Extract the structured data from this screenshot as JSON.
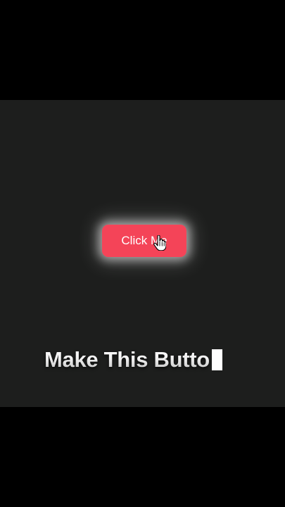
{
  "demo": {
    "button_label": "Click Me",
    "button_color": "#f44458",
    "button_glow": "#ffffff",
    "cursor_icon": "hand-pointer-icon"
  },
  "caption": {
    "text": "Make This Butto"
  },
  "colors": {
    "letterbox": "#000000",
    "stage_background": "#1d1e1d",
    "caption_text": "#e9e9e9"
  }
}
